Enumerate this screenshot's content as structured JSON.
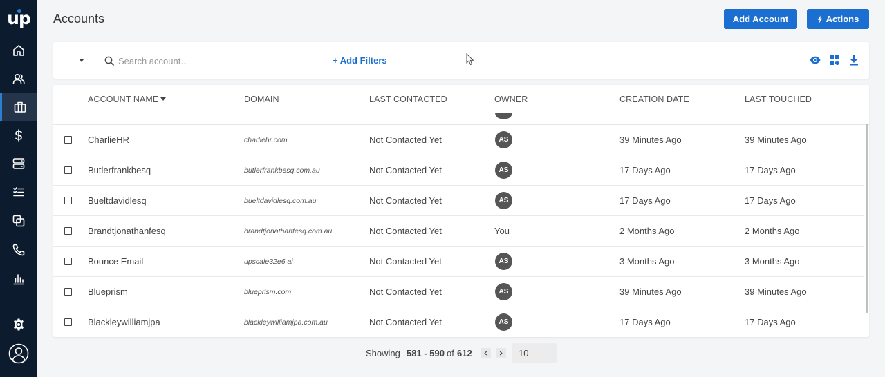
{
  "app": {
    "logo_text": "up"
  },
  "sidebar": {
    "items": [
      {
        "icon": "home-icon"
      },
      {
        "icon": "contacts-icon"
      },
      {
        "icon": "briefcase-icon",
        "active": true
      },
      {
        "icon": "dollar-icon"
      },
      {
        "icon": "sequences-icon"
      },
      {
        "icon": "tasks-icon"
      },
      {
        "icon": "templates-icon"
      },
      {
        "icon": "phone-icon"
      },
      {
        "icon": "reports-icon"
      },
      {
        "icon": "settings-icon"
      },
      {
        "icon": "profile-icon"
      }
    ]
  },
  "header": {
    "title": "Accounts",
    "add_account_label": "Add Account",
    "actions_label": "Actions"
  },
  "filters": {
    "search_placeholder": "Search account...",
    "add_filters_label": "+ Add Filters"
  },
  "table": {
    "columns": [
      "ACCOUNT NAME",
      "DOMAIN",
      "LAST CONTACTED",
      "OWNER",
      "CREATION DATE",
      "LAST TOUCHED"
    ],
    "rows": [
      {
        "name": "CharlieHR",
        "domain": "charliehr.com",
        "last_contacted": "Not Contacted Yet",
        "owner": "AS",
        "owner_type": "avatar",
        "created": "39 Minutes Ago",
        "touched": "39 Minutes Ago"
      },
      {
        "name": "Butlerfrankbesq",
        "domain": "butlerfrankbesq.com.au",
        "last_contacted": "Not Contacted Yet",
        "owner": "AS",
        "owner_type": "avatar",
        "created": "17 Days Ago",
        "touched": "17 Days Ago"
      },
      {
        "name": "Bueltdavidlesq",
        "domain": "bueltdavidlesq.com.au",
        "last_contacted": "Not Contacted Yet",
        "owner": "AS",
        "owner_type": "avatar",
        "created": "17 Days Ago",
        "touched": "17 Days Ago"
      },
      {
        "name": "Brandtjonathanfesq",
        "domain": "brandtjonathanfesq.com.au",
        "last_contacted": "Not Contacted Yet",
        "owner": "You",
        "owner_type": "text",
        "created": "2 Months Ago",
        "touched": "2 Months Ago"
      },
      {
        "name": "Bounce Email",
        "domain": "upscale32e6.ai",
        "last_contacted": "Not Contacted Yet",
        "owner": "AS",
        "owner_type": "avatar",
        "created": "3 Months Ago",
        "touched": "3 Months Ago"
      },
      {
        "name": "Blueprism",
        "domain": "blueprism.com",
        "last_contacted": "Not Contacted Yet",
        "owner": "AS",
        "owner_type": "avatar",
        "created": "39 Minutes Ago",
        "touched": "39 Minutes Ago"
      },
      {
        "name": "Blackleywilliamjpa",
        "domain": "blackleywilliamjpa.com.au",
        "last_contacted": "Not Contacted Yet",
        "owner": "AS",
        "owner_type": "avatar",
        "created": "17 Days Ago",
        "touched": "17 Days Ago"
      }
    ]
  },
  "pagination": {
    "showing_label": "Showing",
    "range": "581 - 590",
    "of_label": "of",
    "total": "612",
    "page_size": "10"
  },
  "colors": {
    "accent": "#1a6fd1",
    "sidebar": "#0d1b2e",
    "avatar": "#555555"
  }
}
